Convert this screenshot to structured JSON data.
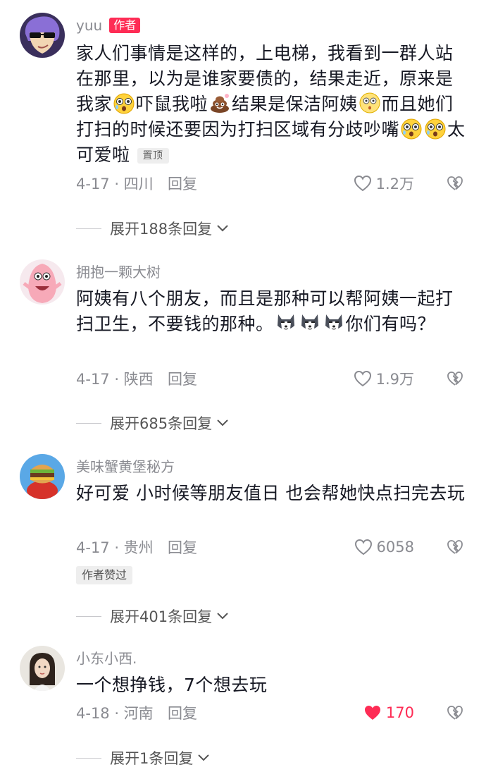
{
  "comments": [
    {
      "username": "yuu",
      "author_tag": "作者",
      "text_parts": [
        "家人们事情是这样的，上电梯，我看到一群人站在那里，以为是谁家要债的，结果走近，原来是我家",
        "吓鼠我啦",
        "结果是保洁阿姨",
        "而且她们打扫的时候还要因为打扫区域有分歧吵嘴",
        "太可爱啦"
      ],
      "pin_tag": "置顶",
      "date": "4-17 · 四川",
      "reply_label": "回复",
      "likes": "1.2万",
      "liked": false,
      "expand_label": "展开188条回复"
    },
    {
      "username": "拥抱一颗大树",
      "text_parts": [
        "阿姨有八个朋友，而且是那种可以帮阿姨一起打扫卫生，不要钱的那种。",
        "你们有吗？"
      ],
      "date": "4-17 · 陕西",
      "reply_label": "回复",
      "likes": "1.9万",
      "liked": false,
      "expand_label": "展开685条回复"
    },
    {
      "username": "美味蟹黄堡秘方",
      "text_parts": [
        "好可爱  小时候等朋友值日  也会帮她快点扫完去玩"
      ],
      "date": "4-17 · 贵州",
      "reply_label": "回复",
      "likes": "6058",
      "liked": false,
      "author_liked_tag": "作者赞过",
      "expand_label": "展开401条回复"
    },
    {
      "username": "小东小西.",
      "text_parts": [
        "一个想挣钱，7个想去玩"
      ],
      "date": "4-18 · 河南",
      "reply_label": "回复",
      "likes": "170",
      "liked": true,
      "expand_label": "展开1条回复"
    }
  ],
  "colors": {
    "accent": "#fe2c55",
    "secondary_text": "#8a8b91",
    "primary_text": "#161823"
  }
}
